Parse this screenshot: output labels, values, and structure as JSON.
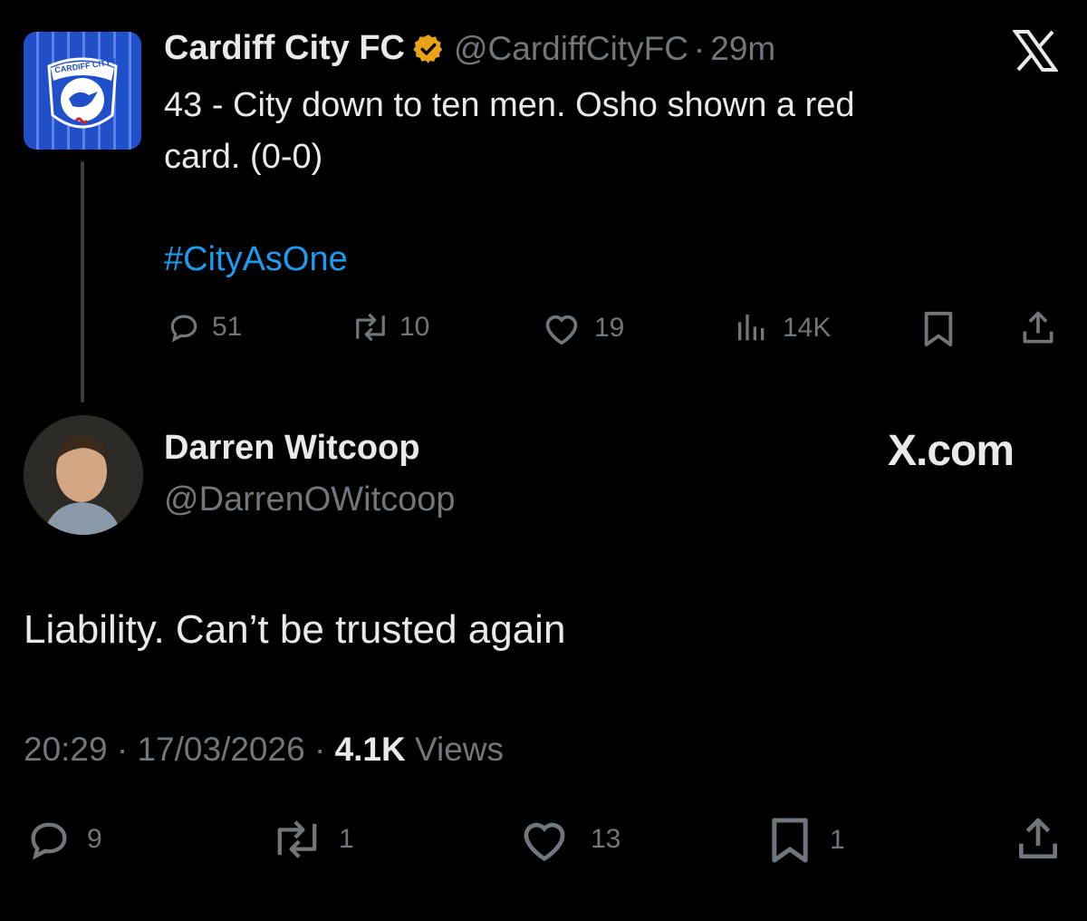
{
  "quoted_tweet": {
    "author_name": "Cardiff City FC",
    "handle": "@CardiffCityFC",
    "separator": "·",
    "time_ago": "29m",
    "text_line1": "43 - City down to ten men. Osho shown a red",
    "text_line2": "card. (0-0)",
    "hashtag": "#CityAsOne",
    "avatar_badge_text": "CARDIFF CITY FC",
    "stats": {
      "replies": "51",
      "reposts": "10",
      "likes": "19",
      "views": "14K"
    },
    "verified_color": "#e8a317",
    "close_icon": "x-logo-icon"
  },
  "reply": {
    "author_name": "Darren Witcoop",
    "handle": "@DarrenOWitcoop",
    "site_label": "X.com",
    "text": "Liability. Can’t be trusted again",
    "time": "20:29",
    "separator": "·",
    "date": "17/03/2026",
    "views_count": "4.1K",
    "views_label": "Views",
    "stats": {
      "replies": "9",
      "reposts": "1",
      "likes": "13",
      "bookmarks": "1"
    }
  },
  "colors": {
    "background": "#000000",
    "text": "#e7e9ea",
    "muted": "#71767b",
    "link": "#1d9bf0"
  }
}
